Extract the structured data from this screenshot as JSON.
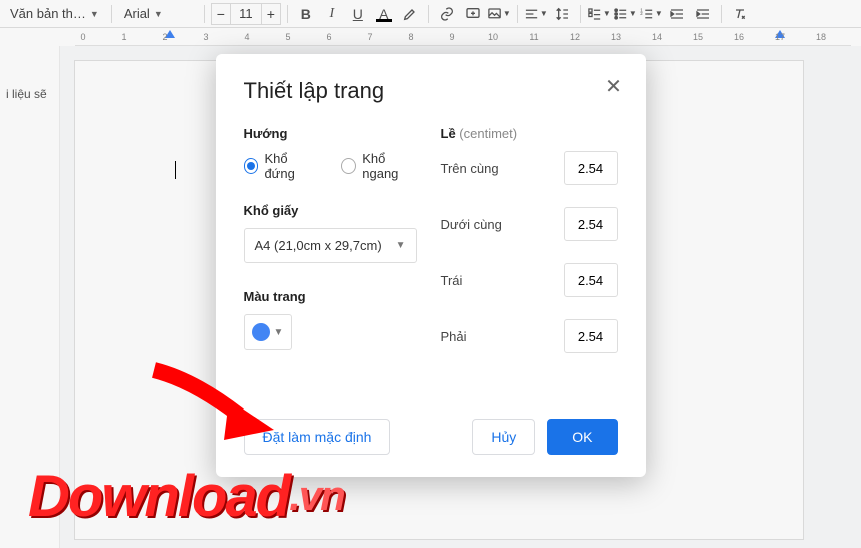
{
  "toolbar": {
    "style_dd": "Văn bản th…",
    "font_dd": "Arial",
    "font_size": "11"
  },
  "ruler": {
    "ticks": [
      0,
      1,
      2,
      3,
      4,
      5,
      6,
      7,
      8,
      9,
      10,
      11,
      12,
      13,
      14,
      15,
      16,
      17,
      18
    ]
  },
  "sidebar": {
    "text": "i liệu sẽ"
  },
  "modal": {
    "title": "Thiết lập trang",
    "orientation": {
      "label": "Hướng",
      "portrait": "Khổ đứng",
      "landscape": "Khổ ngang"
    },
    "paper": {
      "label": "Khổ giấy",
      "value": "A4 (21,0cm x 29,7cm)"
    },
    "color": {
      "label": "Màu trang"
    },
    "margins": {
      "label": "Lề",
      "unit": "(centimet)",
      "top": {
        "label": "Trên cùng",
        "value": "2.54"
      },
      "bottom": {
        "label": "Dưới cùng",
        "value": "2.54"
      },
      "left": {
        "label": "Trái",
        "value": "2.54"
      },
      "right": {
        "label": "Phải",
        "value": "2.54"
      }
    },
    "actions": {
      "set_default": "Đặt làm mặc định",
      "cancel": "Hủy",
      "ok": "OK"
    }
  },
  "watermark": {
    "main": "Download",
    "suffix": ".vn"
  }
}
